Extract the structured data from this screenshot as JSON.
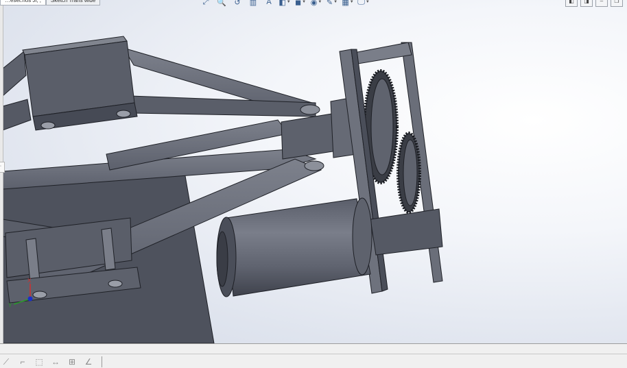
{
  "document_tabs": [
    {
      "label": "…eset.nos Ji, ,",
      "active": true
    },
    {
      "label": "Sketch Trans wide",
      "active": false
    }
  ],
  "heads_up_toolbar": [
    {
      "icon": "zoom-to-fit-icon",
      "glyph": "⤢"
    },
    {
      "icon": "zoom-to-area-icon",
      "glyph": "🔍"
    },
    {
      "icon": "previous-view-icon",
      "glyph": "↺"
    },
    {
      "icon": "section-view-icon",
      "glyph": "▥"
    },
    {
      "icon": "dynamic-annotation-icon",
      "glyph": "A"
    },
    {
      "icon": "view-orientation-icon",
      "glyph": "◧",
      "dropdown": true
    },
    {
      "icon": "display-style-icon",
      "glyph": "◼",
      "dropdown": true
    },
    {
      "icon": "hide-show-items-icon",
      "glyph": "◉",
      "dropdown": true
    },
    {
      "icon": "edit-appearance-icon",
      "glyph": "✎",
      "dropdown": true
    },
    {
      "icon": "apply-scene-icon",
      "glyph": "▦",
      "dropdown": true
    },
    {
      "icon": "view-settings-icon",
      "glyph": "🖵",
      "dropdown": true
    }
  ],
  "window_controls": [
    {
      "icon": "tile-left-icon",
      "glyph": "◧"
    },
    {
      "icon": "tile-right-icon",
      "glyph": "◨"
    },
    {
      "icon": "minimize-icon",
      "glyph": "–"
    },
    {
      "icon": "restore-icon",
      "glyph": "❐"
    }
  ],
  "triad": {
    "x_label": "X",
    "y_label": "Y"
  },
  "left_tab": {
    "glyph": "◦"
  },
  "bottom_toolbar": [
    {
      "icon": "sketch-line-icon",
      "glyph": "⟋"
    },
    {
      "icon": "rectangle-icon",
      "glyph": "⌐"
    },
    {
      "icon": "dashed-rectangle-icon",
      "glyph": "⬚"
    },
    {
      "icon": "dimension-icon",
      "glyph": "↔"
    },
    {
      "icon": "table-icon",
      "glyph": "⊞"
    },
    {
      "icon": "angle-icon",
      "glyph": "∠"
    }
  ],
  "colors": {
    "metal_top": "#6f737f",
    "metal_side": "#4a4e5a",
    "metal_dark": "#2a2c33",
    "gear_teeth": "#3a3d45",
    "viewport_bg": "#e4e8f0",
    "axis_x": "#d23030",
    "axis_y": "#2a9a2a",
    "axis_z": "#1a2fc8"
  }
}
